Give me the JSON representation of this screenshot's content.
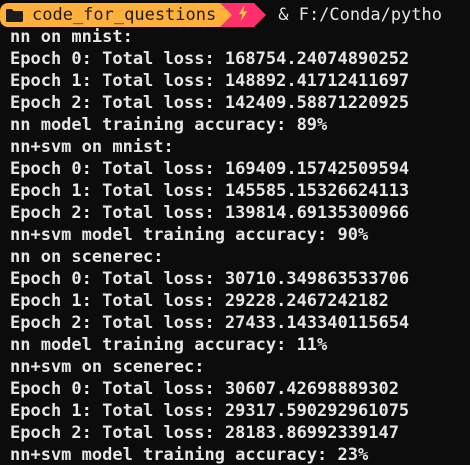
{
  "colors": {
    "background": "#0c0c0c",
    "text": "#e6e6e6",
    "dir_segment_bg": "#ffb13b",
    "dir_segment_fg": "#1c1c1c",
    "git_segment_bg": "#ff2f6d",
    "git_icon": "#ffd23f"
  },
  "prompt": {
    "folder_icon": "folder-icon",
    "directory": "code_for_questions",
    "git_icon": "lightning-icon",
    "command": "& F:/Conda/pytho"
  },
  "output_lines": [
    "nn on mnist:",
    "Epoch 0: Total loss: 168754.24074890252",
    "Epoch 1: Total loss: 148892.41712411697",
    "Epoch 2: Total loss: 142409.58871220925",
    "nn model training accuracy: 89%",
    "nn+svm on mnist:",
    "Epoch 0: Total loss: 169409.15742509594",
    "Epoch 1: Total loss: 145585.15326624113",
    "Epoch 2: Total loss: 139814.69135300966",
    "nn+svm model training accuracy: 90%",
    "nn on scenerec:",
    "Epoch 0: Total loss: 30710.349863533706",
    "Epoch 1: Total loss: 29228.2467242182",
    "Epoch 2: Total loss: 27433.143340115654",
    "nn model training accuracy: 11%",
    "nn+svm on scenerec:",
    "Epoch 0: Total loss: 30607.42698889302",
    "Epoch 1: Total loss: 29317.590292961075",
    "Epoch 2: Total loss: 28183.86992339147",
    "nn+svm model training accuracy: 23%"
  ]
}
